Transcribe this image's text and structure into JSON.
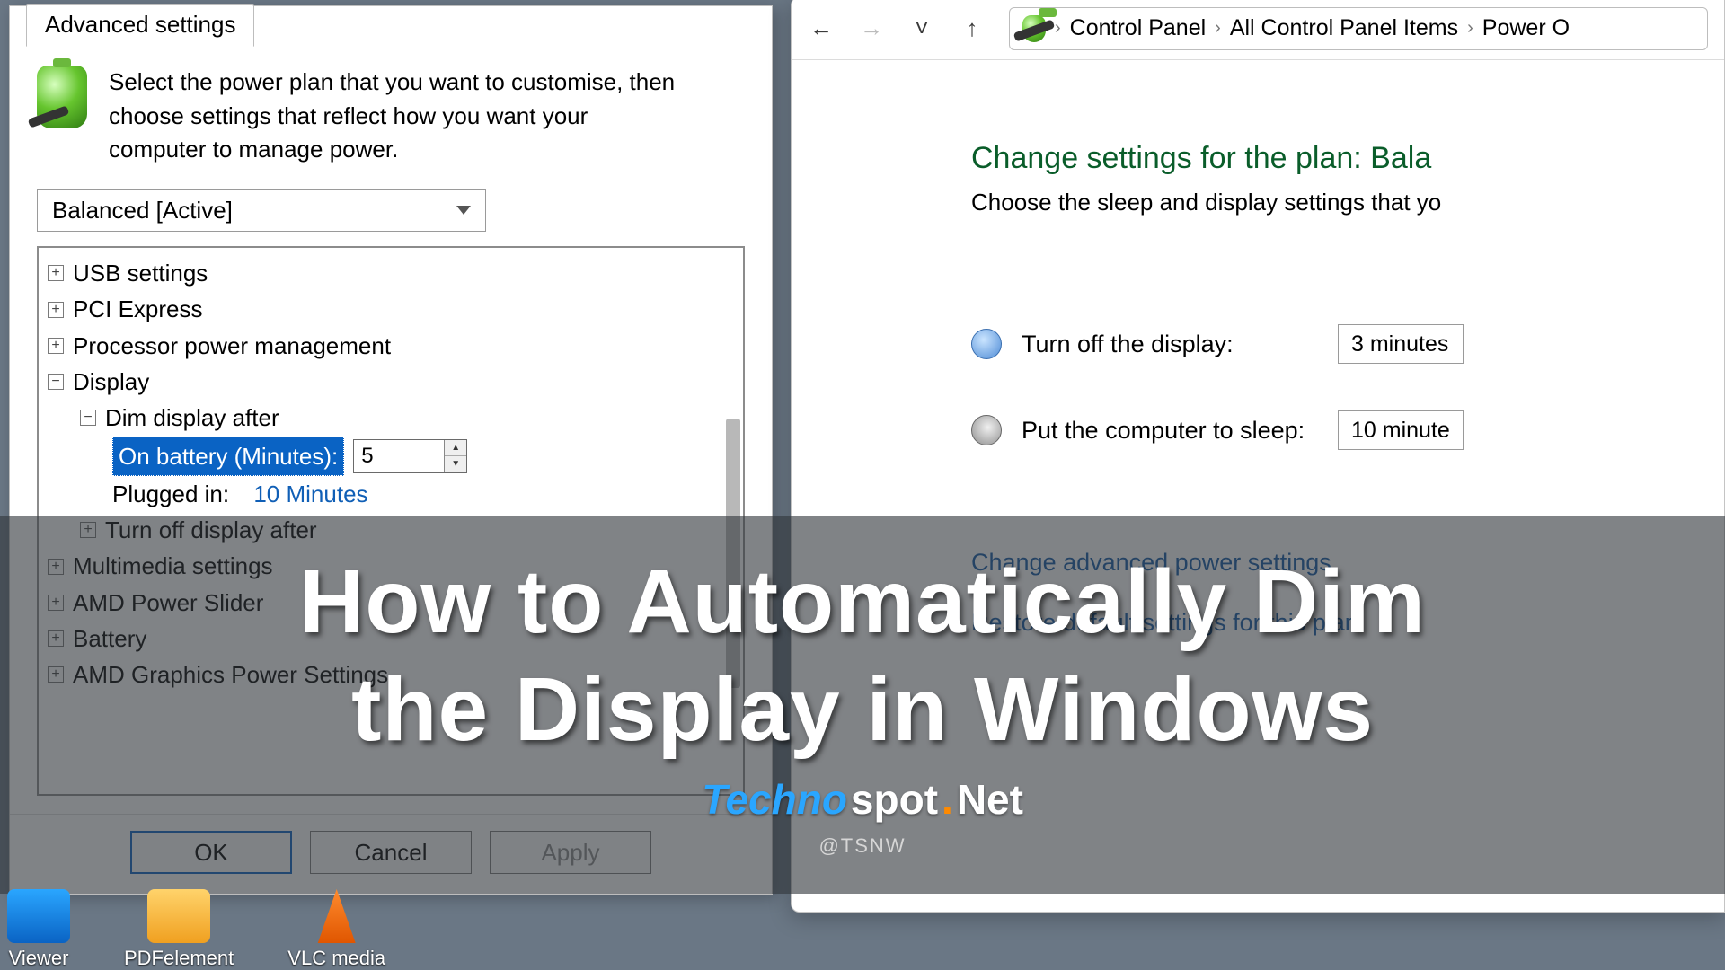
{
  "adv": {
    "tab": "Advanced settings",
    "intro": "Select the power plan that you want to customise, then choose settings that reflect how you want your computer to manage power.",
    "plan": "Balanced [Active]",
    "tree": {
      "usb": "USB settings",
      "pci": "PCI Express",
      "proc": "Processor power management",
      "display": "Display",
      "dim": "Dim display after",
      "on_batt_label": "On battery (Minutes):",
      "on_batt_val": "5",
      "plugged_label": "Plugged in:",
      "plugged_val": "10 Minutes",
      "turn_off": "Turn off display after",
      "multimedia": "Multimedia settings",
      "amd_power": "AMD Power Slider",
      "battery": "Battery",
      "amd_gfx": "AMD Graphics Power Settings"
    },
    "buttons": {
      "ok": "OK",
      "cancel": "Cancel",
      "apply": "Apply"
    }
  },
  "cp": {
    "breadcrumbs": {
      "a": "Control Panel",
      "b": "All Control Panel Items",
      "c": "Power O"
    },
    "heading": "Change settings for the plan: Bala",
    "sub": "Choose the sleep and display settings that yo",
    "rows": {
      "display_label": "Turn off the display:",
      "display_val": "3 minutes",
      "sleep_label": "Put the computer to sleep:",
      "sleep_val": "10 minute"
    },
    "links": {
      "adv": "Change advanced power settings",
      "restore": "Restore default settings for this plan"
    }
  },
  "overlay": {
    "line1": "How to Automatically Dim",
    "line2": "the Display in Windows",
    "brand_t": "Techno",
    "brand_s": "spot",
    "brand_d": ".",
    "brand_n": "Net",
    "handle": "@TSNW"
  },
  "desk": {
    "a": "Viewer",
    "b": "PDFelement",
    "c": "VLC media"
  }
}
